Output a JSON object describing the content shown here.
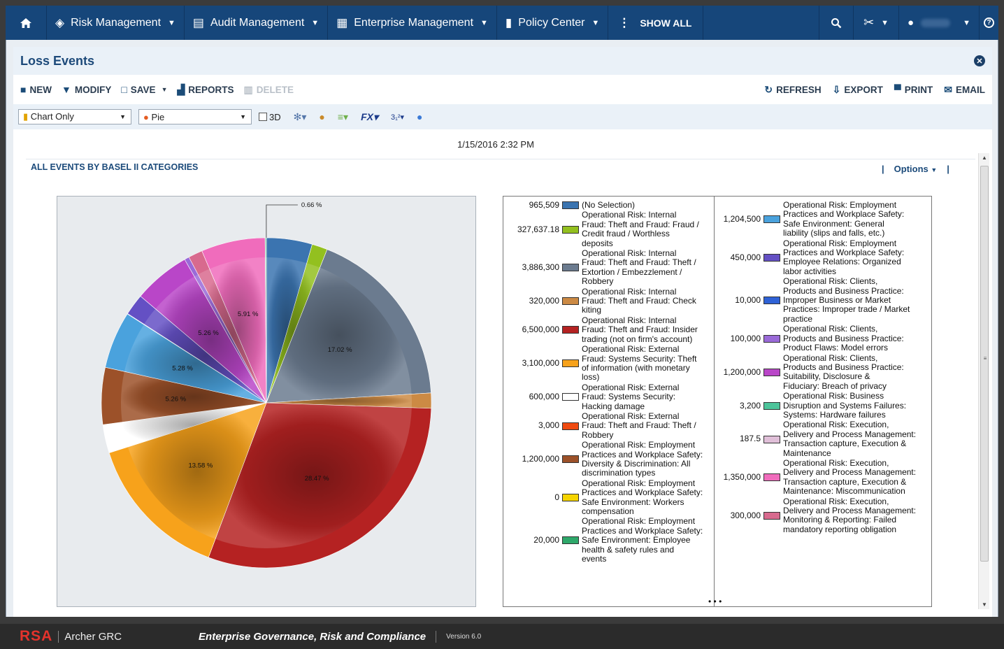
{
  "nav": {
    "home_icon": "home-icon",
    "items": [
      {
        "label": "Risk Management",
        "icon": "risk-target-icon"
      },
      {
        "label": "Audit Management",
        "icon": "document-icon"
      },
      {
        "label": "Enterprise Management",
        "icon": "building-icon"
      },
      {
        "label": "Policy Center",
        "icon": "book-icon"
      }
    ],
    "show_all": "SHOW ALL"
  },
  "page": {
    "title": "Loss Events"
  },
  "toolbar": {
    "new": "NEW",
    "modify": "MODIFY",
    "save": "SAVE",
    "reports": "REPORTS",
    "delete": "DELETE",
    "refresh": "REFRESH",
    "export": "EXPORT",
    "print": "PRINT",
    "email": "EMAIL"
  },
  "options_bar": {
    "display_mode": "Chart Only",
    "chart_type": "Pie",
    "three_d_label": "3D",
    "fx_label": "FX",
    "sort_label": "3₁²"
  },
  "report": {
    "timestamp": "1/15/2016 2:32 PM",
    "heading": "ALL EVENTS BY BASEL II CATEGORIES",
    "options_label": "Options"
  },
  "chart_data": {
    "type": "pie",
    "slices": [
      {
        "value": "965,509",
        "label": "(No Selection)",
        "color": "#3b74b0",
        "percent": ""
      },
      {
        "value": "327,637.18",
        "label": "Operational Risk: Internal Fraud: Theft and Fraud: Fraud / Credit fraud / Worthless deposits",
        "color": "#93c01f",
        "percent": ""
      },
      {
        "value": "3,886,300",
        "label": "Operational Risk: Internal Fraud: Theft and Fraud: Theft / Extortion / Embezzlement / Robbery",
        "color": "#6b7b8f",
        "percent": "17.02 %"
      },
      {
        "value": "320,000",
        "label": "Operational Risk: Internal Fraud: Theft and Fraud: Check kiting",
        "color": "#cc8a44",
        "percent": ""
      },
      {
        "value": "6,500,000",
        "label": "Operational Risk: Internal Fraud: Theft and Fraud: Insider trading (not on firm's account)",
        "color": "#b52222",
        "percent": "28.47 %"
      },
      {
        "value": "3,100,000",
        "label": "Operational Risk: External Fraud: Systems Security: Theft of information (with monetary loss)",
        "color": "#f7a21b",
        "percent": "13.58 %"
      },
      {
        "value": "600,000",
        "label": "Operational Risk: External Fraud: Systems Security: Hacking damage",
        "color": "#ffffff",
        "percent": ""
      },
      {
        "value": "3,000",
        "label": "Operational Risk: External Fraud: Theft and Fraud: Theft / Robbery",
        "color": "#f04a10",
        "percent": ""
      },
      {
        "value": "1,200,000",
        "label": "Operational Risk: Employment Practices and Workplace Safety: Diversity & Discrimination: All discrimination types",
        "color": "#9c5129",
        "percent": "5.26 %"
      },
      {
        "value": "0",
        "label": "Operational Risk: Employment Practices and Workplace Safety: Safe Environment: Workers compensation",
        "color": "#f5d400",
        "percent": ""
      },
      {
        "value": "20,000",
        "label": "Operational Risk: Employment Practices and Workplace Safety: Safe Environment: Employee health & safety rules and events",
        "color": "#2ea86a",
        "percent": ""
      },
      {
        "value": "1,204,500",
        "label": "Operational Risk: Employment Practices and Workplace Safety: Safe Environment: General liability (slips and falls, etc.)",
        "color": "#4aa2dd",
        "percent": "5.28 %"
      },
      {
        "value": "450,000",
        "label": "Operational Risk: Employment Practices and Workplace Safety: Employee Relations: Organized labor activities",
        "color": "#6450c4",
        "percent": ""
      },
      {
        "value": "10,000",
        "label": "Operational Risk: Clients, Products and Business Practice: Improper Business or Market Practices: Improper trade / Market practice",
        "color": "#2f62d6",
        "percent": ""
      },
      {
        "value": "100,000",
        "label": "Operational Risk: Clients, Products and Business Practice: Product Flaws: Model errors",
        "color": "#9a6ad8",
        "percent": ""
      },
      {
        "value": "1,200,000",
        "label": "Operational Risk: Clients, Products and Business Practice: Suitability, Disclosure & Fiduciary: Breach of privacy",
        "color": "#b946c8",
        "percent": "5.26 %"
      },
      {
        "value": "3,200",
        "label": "Operational Risk: Business Disruption and Systems Failures: Systems: Hardware failures",
        "color": "#4cc49a",
        "percent": ""
      },
      {
        "value": "187.5",
        "label": "Operational Risk: Execution, Delivery and Process Management: Transaction capture, Execution & Maintenance",
        "color": "#e0bfd8",
        "percent": ""
      },
      {
        "value": "1,350,000",
        "label": "Operational Risk: Execution, Delivery and Process Management: Transaction capture, Execution & Maintenance: Miscommunication",
        "color": "#f06cbc",
        "percent": "5.91 %"
      },
      {
        "value": "300,000",
        "label": "Operational Risk: Execution, Delivery and Process Management: Monitoring & Reporting: Failed mandatory reporting obligation",
        "color": "#d86a8e",
        "percent": ""
      }
    ],
    "callout": "0.66 %"
  },
  "footer": {
    "brand": "RSA",
    "product": "Archer GRC",
    "tagline": "Enterprise Governance, Risk and Compliance",
    "version": "Version 6.0"
  }
}
